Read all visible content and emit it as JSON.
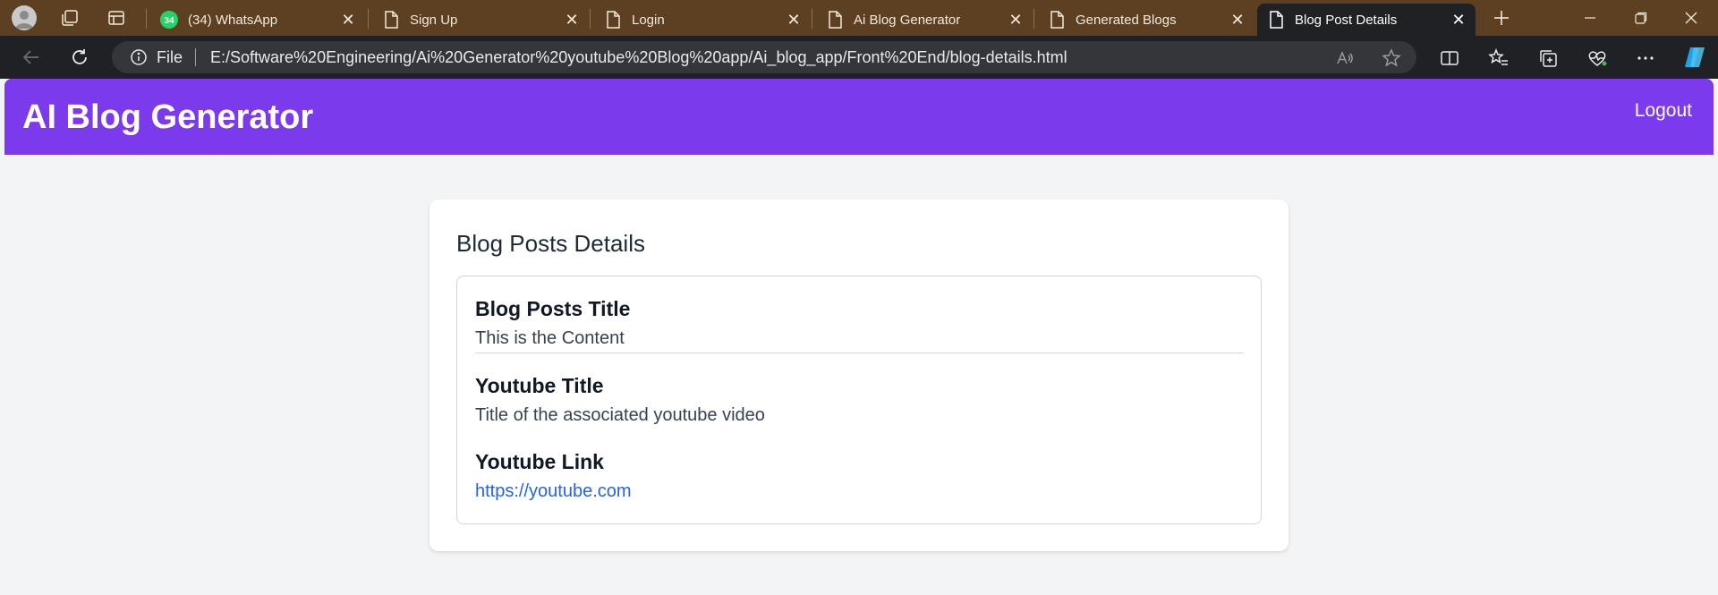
{
  "browser": {
    "tabs": [
      {
        "label": "(34) WhatsApp",
        "badge": "34"
      },
      {
        "label": "Sign Up"
      },
      {
        "label": "Login"
      },
      {
        "label": "Ai Blog Generator"
      },
      {
        "label": "Generated Blogs"
      },
      {
        "label": "Blog Post Details"
      }
    ],
    "active_tab_index": 5,
    "address": {
      "scheme_label": "File",
      "url": "E:/Software%20Engineering/Ai%20Generator%20youtube%20Blog%20app/Ai_blog_app/Front%20End/blog-details.html"
    }
  },
  "page": {
    "navbar": {
      "brand": "AI Blog Generator",
      "logout_label": "Logout",
      "color": "#7c3aed"
    },
    "card": {
      "heading": "Blog Posts Details",
      "sections": [
        {
          "title": "Blog Posts Title",
          "text": "This is the Content"
        },
        {
          "title": "Youtube Title",
          "text": "Title of the associated youtube video"
        },
        {
          "title": "Youtube Link",
          "link": "https://youtube.com"
        }
      ]
    }
  },
  "colors": {
    "tabbar": "#5c4021",
    "chrome_dark": "#202124",
    "page_bg": "#f3f4f6",
    "link": "#2563eb"
  },
  "icons": [
    "profile-avatar",
    "workspaces-icon",
    "tab-actions-icon",
    "whatsapp-icon",
    "page-icon",
    "close-icon",
    "new-tab-icon",
    "minimize-icon",
    "restore-icon",
    "window-close-icon",
    "back-icon",
    "refresh-icon",
    "info-icon",
    "read-aloud-icon",
    "favorite-star-icon",
    "split-screen-icon",
    "favorites-icon",
    "collections-icon",
    "health-icon",
    "more-icon",
    "copilot-icon"
  ]
}
